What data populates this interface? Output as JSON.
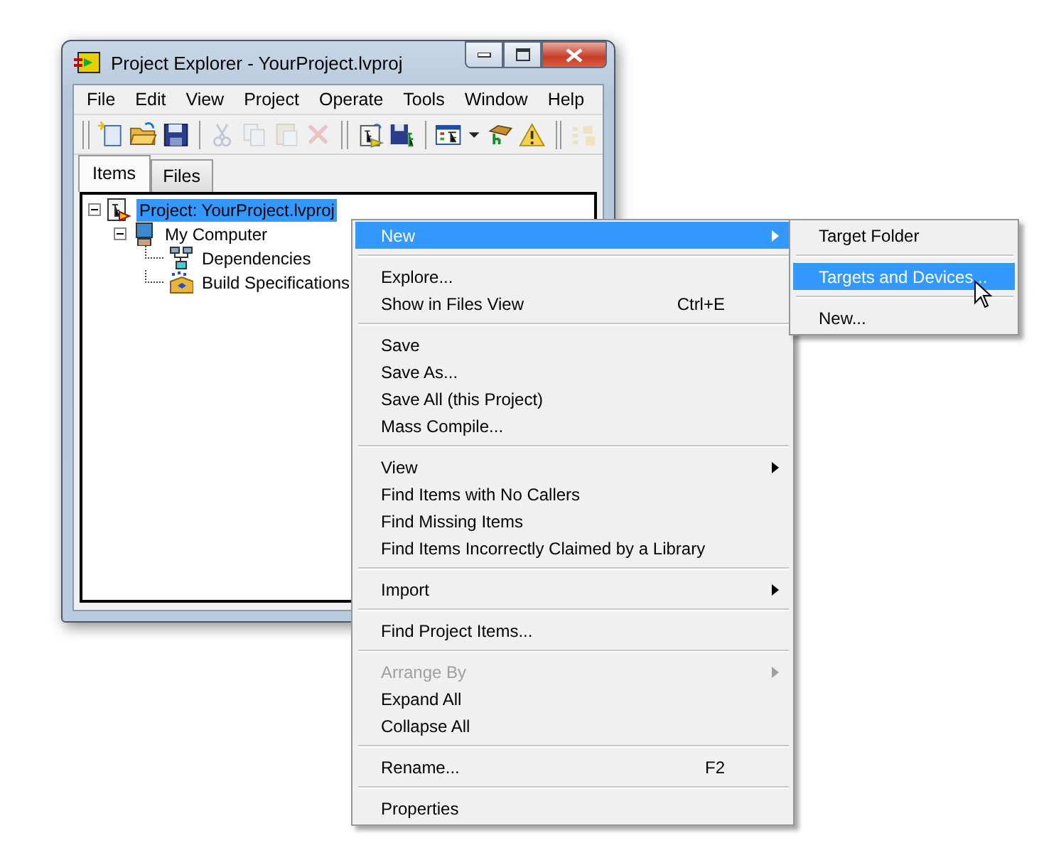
{
  "window": {
    "title": "Project Explorer - YourProject.lvproj"
  },
  "menubar": [
    "File",
    "Edit",
    "View",
    "Project",
    "Operate",
    "Tools",
    "Window",
    "Help"
  ],
  "toolbar": [
    {
      "kind": "new",
      "disabled": false
    },
    {
      "kind": "open",
      "disabled": false
    },
    {
      "kind": "save",
      "disabled": false
    },
    {
      "kind": "sep"
    },
    {
      "kind": "cut",
      "disabled": true
    },
    {
      "kind": "copy",
      "disabled": true
    },
    {
      "kind": "paste",
      "disabled": true
    },
    {
      "kind": "delete",
      "disabled": true
    },
    {
      "kind": "bar"
    },
    {
      "kind": "project",
      "disabled": false
    },
    {
      "kind": "saveall",
      "disabled": false
    },
    {
      "kind": "sep"
    },
    {
      "kind": "view",
      "disabled": false
    },
    {
      "kind": "dropdown",
      "disabled": false
    },
    {
      "kind": "deploy",
      "disabled": false
    },
    {
      "kind": "warning",
      "disabled": false
    },
    {
      "kind": "bar"
    },
    {
      "kind": "build",
      "disabled": true
    }
  ],
  "tabs": [
    {
      "label": "Items",
      "selected": true
    },
    {
      "label": "Files",
      "selected": false
    }
  ],
  "tree": [
    {
      "kind": "project",
      "label": "Project: YourProject.lvproj",
      "selected": true,
      "expanded": true,
      "children": [
        {
          "kind": "computer",
          "label": "My Computer",
          "selected": false,
          "expanded": true,
          "children": [
            {
              "kind": "dependencies",
              "label": "Dependencies",
              "selected": false
            },
            {
              "kind": "build",
              "label": "Build Specifications",
              "selected": false
            }
          ]
        }
      ]
    }
  ],
  "context_menu": {
    "groups": [
      [
        {
          "label": "New",
          "submenu": true,
          "selected": true,
          "disabled": false
        }
      ],
      [
        {
          "label": "Explore...",
          "selected": false,
          "disabled": false
        },
        {
          "label": "Show in Files View",
          "shortcut": "Ctrl+E",
          "selected": false,
          "disabled": false
        }
      ],
      [
        {
          "label": "Save",
          "selected": false,
          "disabled": false
        },
        {
          "label": "Save As...",
          "selected": false,
          "disabled": false
        },
        {
          "label": "Save All (this Project)",
          "selected": false,
          "disabled": false
        },
        {
          "label": "Mass Compile...",
          "selected": false,
          "disabled": false
        }
      ],
      [
        {
          "label": "View",
          "submenu": true,
          "selected": false,
          "disabled": false
        },
        {
          "label": "Find Items with No Callers",
          "selected": false,
          "disabled": false
        },
        {
          "label": "Find Missing Items",
          "selected": false,
          "disabled": false
        },
        {
          "label": "Find Items Incorrectly Claimed by a Library",
          "selected": false,
          "disabled": false
        }
      ],
      [
        {
          "label": "Import",
          "submenu": true,
          "selected": false,
          "disabled": false
        }
      ],
      [
        {
          "label": "Find Project Items...",
          "selected": false,
          "disabled": false
        }
      ],
      [
        {
          "label": "Arrange By",
          "submenu": true,
          "selected": false,
          "disabled": true
        },
        {
          "label": "Expand All",
          "selected": false,
          "disabled": false
        },
        {
          "label": "Collapse All",
          "selected": false,
          "disabled": false
        }
      ],
      [
        {
          "label": "Rename...",
          "shortcut": "F2",
          "selected": false,
          "disabled": false
        }
      ],
      [
        {
          "label": "Properties",
          "selected": false,
          "disabled": false
        }
      ]
    ]
  },
  "submenu": {
    "groups": [
      [
        {
          "label": "Target Folder",
          "selected": false,
          "disabled": false
        }
      ],
      [
        {
          "label": "Targets and Devices...",
          "selected": true,
          "disabled": false
        }
      ],
      [
        {
          "label": "New...",
          "selected": false,
          "disabled": false
        }
      ]
    ]
  }
}
